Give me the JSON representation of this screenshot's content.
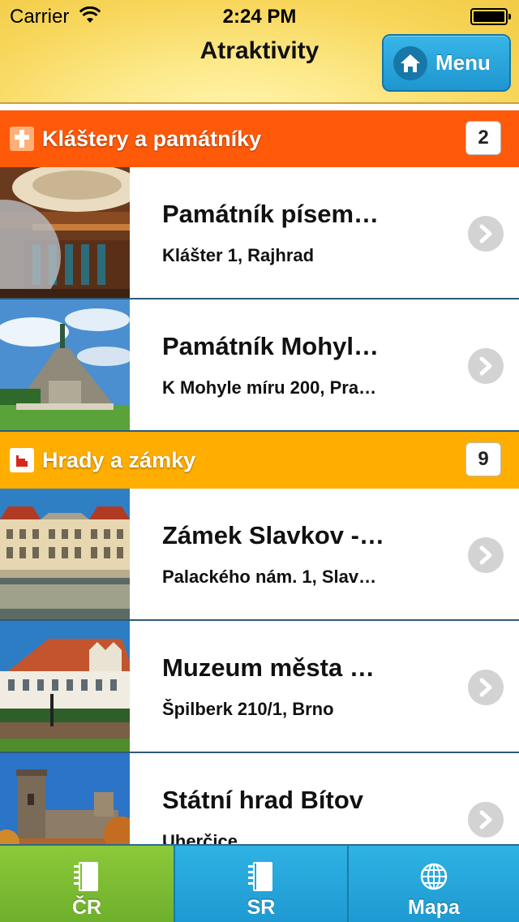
{
  "status_bar": {
    "carrier": "Carrier",
    "time": "2:24 PM"
  },
  "header": {
    "title": "Atraktivity",
    "menu_label": "Menu",
    "menu_icon": "home-icon"
  },
  "sections": [
    {
      "title": "Kláštery a památníky",
      "count": "2",
      "color": "#ff5a0a",
      "icon": "cross-icon",
      "items": [
        {
          "title": "Památník písem…",
          "subtitle": "Klášter 1, Rajhrad",
          "image": "library-interior"
        },
        {
          "title": "Památník Mohyl…",
          "subtitle": "K Mohyle míru 200, Pra…",
          "image": "peace-monument"
        }
      ]
    },
    {
      "title": "Hrady a zámky",
      "count": "9",
      "color": "#ffae00",
      "icon": "castle-icon",
      "items": [
        {
          "title": "Zámek Slavkov -…",
          "subtitle": "Palackého nám. 1, Slav…",
          "image": "slavkov-chateau"
        },
        {
          "title": "Muzeum města …",
          "subtitle": "Špilberk 210/1, Brno",
          "image": "spilberk-castle"
        },
        {
          "title": "Státní hrad Bítov",
          "subtitle": "Uherčice",
          "image": "bitov-castle"
        }
      ]
    }
  ],
  "tabs": [
    {
      "label": "ČR",
      "icon": "notebook-icon",
      "active": true
    },
    {
      "label": "SR",
      "icon": "notebook-icon",
      "active": false
    },
    {
      "label": "Mapa",
      "icon": "globe-icon",
      "active": false
    }
  ]
}
